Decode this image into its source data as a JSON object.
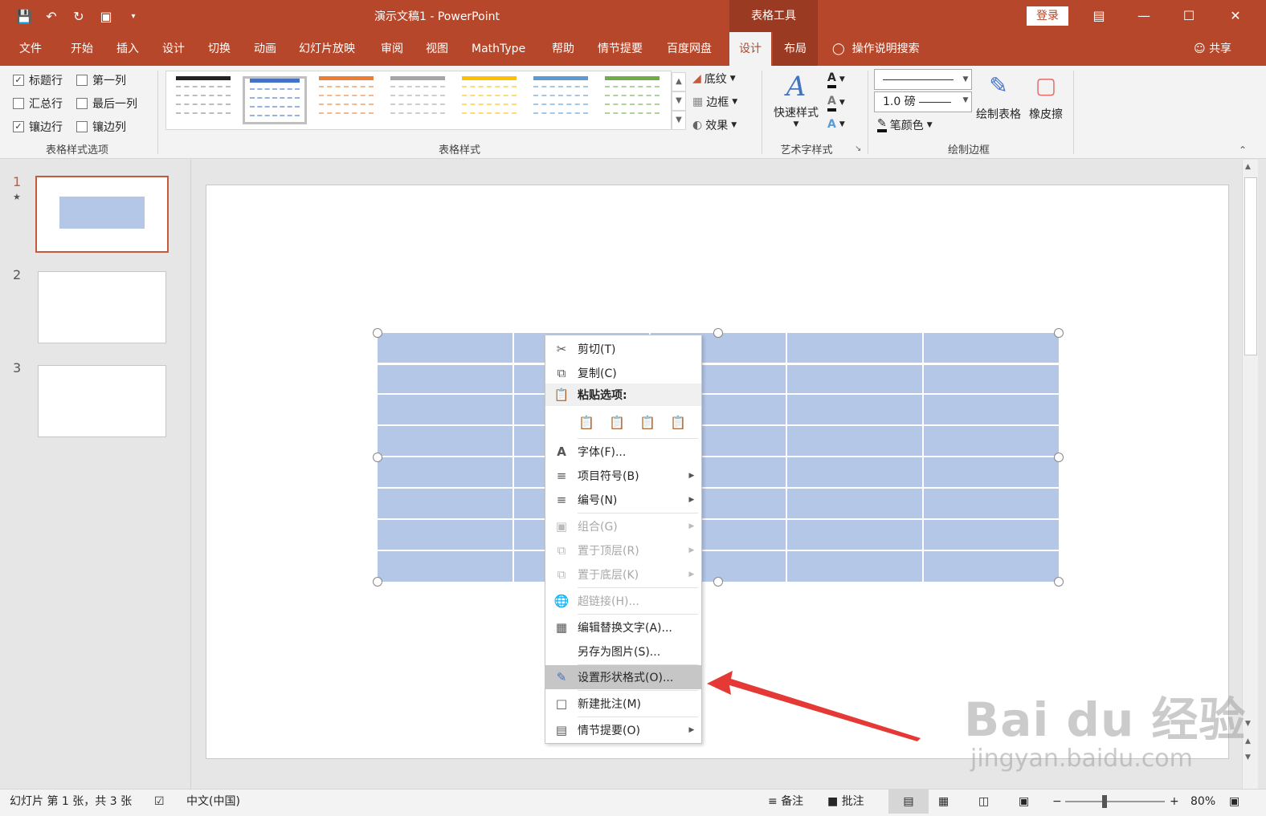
{
  "app": {
    "title": "演示文稿1 - PowerPoint",
    "context_tab_group": "表格工具",
    "login": "登录"
  },
  "tabs": [
    "文件",
    "开始",
    "插入",
    "设计",
    "切换",
    "动画",
    "幻灯片放映",
    "审阅",
    "视图",
    "MathType",
    "帮助",
    "情节提要",
    "百度网盘"
  ],
  "context_tabs": [
    "设计",
    "布局"
  ],
  "tell_me": "操作说明搜索",
  "share": "共享",
  "ribbon": {
    "style_options": {
      "label": "表格样式选项",
      "header_row": "标题行",
      "first_column": "第一列",
      "total_row": "汇总行",
      "last_column": "最后一列",
      "banded_rows": "镶边行",
      "banded_columns": "镶边列"
    },
    "table_styles": {
      "label": "表格样式",
      "shading": "底纹",
      "borders": "边框",
      "effects": "效果",
      "swatch_colors": [
        "#222222",
        "#4472c4",
        "#ed7d31",
        "#a5a5a5",
        "#ffc000",
        "#5b9bd5",
        "#70ad47"
      ]
    },
    "wordart": {
      "label": "艺术字样式",
      "quick_styles": "快速样式"
    },
    "draw_borders": {
      "label": "绘制边框",
      "weight": "1.0 磅",
      "pen_color": "笔颜色",
      "draw_table": "绘制表格",
      "eraser": "橡皮擦"
    }
  },
  "slides": [
    {
      "number": "1"
    },
    {
      "number": "2"
    },
    {
      "number": "3"
    }
  ],
  "context_menu": {
    "cut": "剪切(T)",
    "copy": "复制(C)",
    "paste_options": "粘贴选项:",
    "font": "字体(F)...",
    "bullets": "项目符号(B)",
    "numbering": "编号(N)",
    "group": "组合(G)",
    "bring_to_front": "置于顶层(R)",
    "send_to_back": "置于底层(K)",
    "hyperlink": "超链接(H)...",
    "edit_alt_text": "编辑替换文字(A)...",
    "save_as_picture": "另存为图片(S)...",
    "format_shape": "设置形状格式(O)...",
    "new_comment": "新建批注(M)",
    "storyboard": "情节提要(O)"
  },
  "watermark": {
    "brand": "Bai du 经验",
    "url": "jingyan.baidu.com"
  },
  "statusbar": {
    "slide_info": "幻灯片 第 1 张，共 3 张",
    "language": "中文(中国)",
    "notes": "备注",
    "comments": "批注",
    "zoom": "80%"
  },
  "colors": {
    "accent": "#b7472a",
    "table_fill": "#b4c7e7",
    "arrow": "#e53935"
  }
}
